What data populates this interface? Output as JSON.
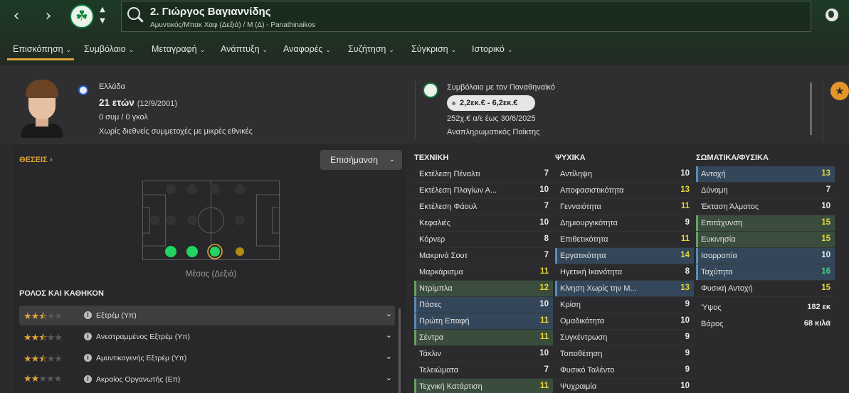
{
  "header": {
    "player_title": "2. Γιώργος Βαγιαννίδης",
    "player_subtitle": "Αμυντικός/Μπακ Χαφ (Δεξιά) / Μ (Δ) - Panathinaikos",
    "icons": [
      "back-arrow-icon",
      "forward-arrow-icon",
      "club-crest-icon",
      "search-icon",
      "globe-icon"
    ]
  },
  "tabs": [
    "Επισκόπηση",
    "Συμβόλαιο",
    "Μεταγραφή",
    "Ανάπτυξη",
    "Αναφορές",
    "Συζήτηση",
    "Σύγκριση",
    "Ιστορικό"
  ],
  "summary": {
    "nationality": "Ελλάδα",
    "age": "21 ετών",
    "dob": "(12/9/2001)",
    "caps": "0 συμ / 0 γκολ",
    "youth_caps": "Χωρίς διεθνείς συμμετοχές με μικρές εθνικές",
    "contract_title": "Συμβόλαιο με τον Παναθηναϊκό",
    "value_range": "2,2εκ.€ - 6,2εκ.€",
    "wage": "252χ.€ α/ε έως 30/6/2025",
    "squad_status": "Αναπληρωματικός Παίκτης"
  },
  "positions": {
    "heading": "ΘΕΣΕΙΣ",
    "highlight_label": "Επισήμανση",
    "current_position": "Μέσος (Δεξιά)",
    "accent": "#e0a43a",
    "natural_color": "#22d462",
    "accomplished_color": "#b08a12"
  },
  "roles": {
    "heading": "ΡΟΛΟΣ ΚΑΙ ΚΑΘΗΚΟΝ",
    "items": [
      {
        "name": "Εξτρέμ (Υπ)",
        "stars": 2.5
      },
      {
        "name": "Ανεστραμμένος Εξτρέμ (Υπ)",
        "stars": 2.5
      },
      {
        "name": "Αμυντικογενής Εξτρέμ (Υπ)",
        "stars": 2.5
      },
      {
        "name": "Ακραίος Οργανωτής (Επ)",
        "stars": 2
      }
    ]
  },
  "attributes": {
    "technical": {
      "heading": "ΤΕΧΝΙΚΗ",
      "rows": [
        {
          "name": "Εκτέλεση Πέναλτι",
          "value": "7",
          "hl": ""
        },
        {
          "name": "Εκτέλεση Πλαγίων Α...",
          "value": "10",
          "hl": ""
        },
        {
          "name": "Εκτέλεση Φάουλ",
          "value": "7",
          "hl": ""
        },
        {
          "name": "Κεφαλιές",
          "value": "10",
          "hl": ""
        },
        {
          "name": "Κόρνερ",
          "value": "8",
          "hl": ""
        },
        {
          "name": "Μακρινά Σουτ",
          "value": "7",
          "hl": ""
        },
        {
          "name": "Μαρκάρισμα",
          "value": "11",
          "hl": ""
        },
        {
          "name": "Ντρίμπλα",
          "value": "12",
          "hl": "green"
        },
        {
          "name": "Πάσες",
          "value": "10",
          "hl": "blue"
        },
        {
          "name": "Πρώτη Επαφή",
          "value": "11",
          "hl": "blue"
        },
        {
          "name": "Σέντρα",
          "value": "11",
          "hl": "green"
        },
        {
          "name": "Τάκλιν",
          "value": "10",
          "hl": ""
        },
        {
          "name": "Τελειώματα",
          "value": "7",
          "hl": ""
        },
        {
          "name": "Τεχνική Κατάρτιση",
          "value": "11",
          "hl": "green"
        }
      ]
    },
    "mental": {
      "heading": "ΨΥΧΙΚΑ",
      "rows": [
        {
          "name": "Αντίληψη",
          "value": "10",
          "hl": ""
        },
        {
          "name": "Αποφασιστικότητα",
          "value": "13",
          "hl": ""
        },
        {
          "name": "Γενναιότητα",
          "value": "11",
          "hl": ""
        },
        {
          "name": "Δημιουργικότητα",
          "value": "9",
          "hl": ""
        },
        {
          "name": "Επιθετικότητα",
          "value": "11",
          "hl": ""
        },
        {
          "name": "Εργατικότητα",
          "value": "14",
          "hl": "blue"
        },
        {
          "name": "Ηγετική Ικανότητα",
          "value": "8",
          "hl": ""
        },
        {
          "name": "Κίνηση Χωρίς την Μ...",
          "value": "13",
          "hl": "blue"
        },
        {
          "name": "Κρίση",
          "value": "9",
          "hl": ""
        },
        {
          "name": "Ομαδικότητα",
          "value": "10",
          "hl": ""
        },
        {
          "name": "Συγκέντρωση",
          "value": "9",
          "hl": ""
        },
        {
          "name": "Τοποθέτηση",
          "value": "9",
          "hl": ""
        },
        {
          "name": "Φυσικό Ταλέντο",
          "value": "9",
          "hl": ""
        },
        {
          "name": "Ψυχραιμία",
          "value": "10",
          "hl": ""
        }
      ]
    },
    "physical": {
      "heading": "ΣΩΜΑΤΙΚΑ/ΦΥΣΙΚΑ",
      "rows": [
        {
          "name": "Αντοχή",
          "value": "13",
          "hl": "blue"
        },
        {
          "name": "Δύναμη",
          "value": "7",
          "hl": ""
        },
        {
          "name": "Έκταση Άλματος",
          "value": "10",
          "hl": ""
        },
        {
          "name": "Επιτάχυνση",
          "value": "15",
          "hl": "green"
        },
        {
          "name": "Ευκινησία",
          "value": "15",
          "hl": "green"
        },
        {
          "name": "Ισορροπία",
          "value": "10",
          "hl": "blue"
        },
        {
          "name": "Ταχύτητα",
          "value": "16",
          "hl": "blue"
        },
        {
          "name": "Φυσική Αντοχή",
          "value": "15",
          "hl": ""
        }
      ],
      "height_label": "Ύψος",
      "height_value": "182 εκ",
      "weight_label": "Βάρος",
      "weight_value": "68 κιλά"
    }
  }
}
